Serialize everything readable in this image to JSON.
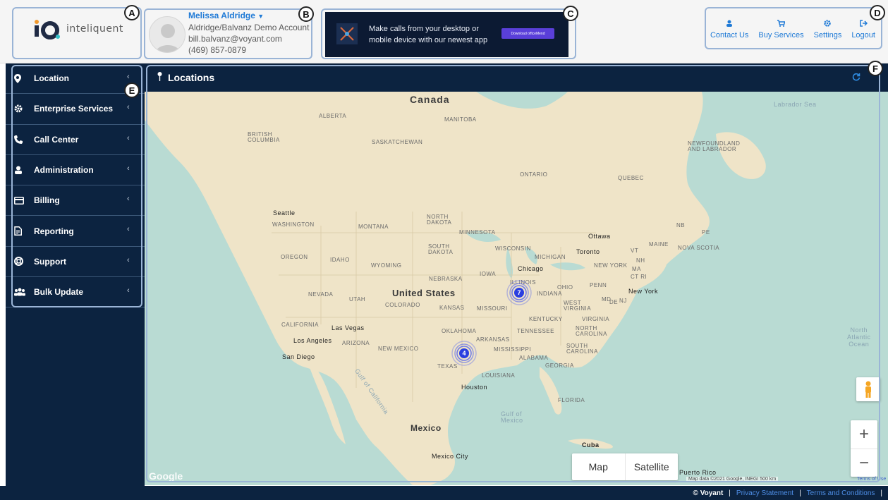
{
  "brand": {
    "name": "inteliquent"
  },
  "user": {
    "name": "Melissa Aldridge",
    "account": "Aldridge/Balvanz Demo Account",
    "email": "bill.balvanz@voyant.com",
    "phone": "(469) 857-0879"
  },
  "banner": {
    "line1": "Make calls from your desktop or",
    "line2": "mobile device with our newest app",
    "button": "Download officeMend"
  },
  "top_actions": [
    {
      "label": "Contact Us",
      "icon": "person-icon"
    },
    {
      "label": "Buy Services",
      "icon": "cart-icon"
    },
    {
      "label": "Settings",
      "icon": "gear-icon"
    },
    {
      "label": "Logout",
      "icon": "logout-icon"
    }
  ],
  "sidebar": {
    "items": [
      {
        "label": "Location",
        "icon": "pin-icon"
      },
      {
        "label": "Enterprise Services",
        "icon": "gear-icon"
      },
      {
        "label": "Call Center",
        "icon": "phone-icon"
      },
      {
        "label": "Administration",
        "icon": "person-icon"
      },
      {
        "label": "Billing",
        "icon": "card-icon"
      },
      {
        "label": "Reporting",
        "icon": "document-icon"
      },
      {
        "label": "Support",
        "icon": "lifebuoy-icon"
      },
      {
        "label": "Bulk Update",
        "icon": "users-icon"
      }
    ]
  },
  "panel": {
    "title": "Locations"
  },
  "callouts": [
    "A",
    "B",
    "C",
    "D",
    "E",
    "F"
  ],
  "map": {
    "labels": {
      "canada": "Canada",
      "labrador_sea": "Labrador Sea",
      "alberta": "ALBERTA",
      "manitoba": "MANITOBA",
      "bc": "BRITISH\nCOLUMBIA",
      "saskatchewan": "SASKATCHEWAN",
      "newfoundland": "NEWFOUNDLAND\nAND LABRADOR",
      "ontario": "ONTARIO",
      "quebec": "QUEBEC",
      "seattle": "Seattle",
      "washington": "WASHINGTON",
      "montana": "MONTANA",
      "north_dakota": "NORTH\nDAKOTA",
      "minnesota": "MINNESOTA",
      "ottawa": "Ottawa",
      "nb": "NB",
      "pe": "PE",
      "maine": "MAINE",
      "nova_scotia": "NOVA SCOTIA",
      "oregon": "OREGON",
      "idaho": "IDAHO",
      "south_dakota": "SOUTH\nDAKOTA",
      "wisconsin": "WISCONSIN",
      "michigan": "MICHIGAN",
      "toronto": "Toronto",
      "vt": "VT",
      "nh": "NH",
      "ma": "MA",
      "ctri": "CT RI",
      "wyoming": "WYOMING",
      "nebraska": "NEBRASKA",
      "iowa": "IOWA",
      "chicago": "Chicago",
      "new_york_state": "NEW YORK",
      "illinois": "ILLINOIS",
      "indiana": "INDIANA",
      "ohio": "OHIO",
      "penn": "PENN",
      "new_york": "New York",
      "nevada": "NEVADA",
      "utah": "UTAH",
      "united_states": "United States",
      "colorado": "COLORADO",
      "kansas": "KANSAS",
      "missouri": "MISSOURI",
      "md": "MD",
      "de": "DE",
      "nj": "NJ",
      "west_virginia": "WEST\nVIRGINIA",
      "kentucky": "KENTUCKY",
      "virginia": "VIRGINIA",
      "california": "CALIFORNIA",
      "las_vegas": "Las Vegas",
      "oklahoma": "OKLAHOMA",
      "tennessee": "TENNESSEE",
      "north_carolina": "NORTH\nCAROLINA",
      "los_angeles": "Los Angeles",
      "arizona": "ARIZONA",
      "new_mexico": "NEW MEXICO",
      "arkansas": "ARKANSAS",
      "mississippi": "MISSISSIPPI",
      "south_carolina": "SOUTH\nCAROLINA",
      "san_diego": "San Diego",
      "alabama": "ALABAMA",
      "georgia": "GEORGIA",
      "texas": "TEXAS",
      "louisiana": "LOUISIANA",
      "houston": "Houston",
      "gulf_california": "Gulf of California",
      "florida": "FLORIDA",
      "gulf_mexico": "Gulf of\nMexico",
      "north_atlantic": "North\nAtlantic\nOcean",
      "mexico": "Mexico",
      "cuba": "Cuba",
      "mexico_city": "Mexico City",
      "puerto_rico": "Puerto Rico"
    },
    "clusters": [
      {
        "count": "7"
      },
      {
        "count": "4"
      }
    ],
    "type_buttons": [
      "Map",
      "Satellite"
    ],
    "zoom_in": "+",
    "zoom_out": "−",
    "google": "Google",
    "attribution": "Map data ©2021 Google, INEGI   500 km",
    "terms": "Terms of Use"
  },
  "footer": {
    "copyright": "© Voyant",
    "privacy": "Privacy Statement",
    "terms": "Terms and Conditions"
  }
}
